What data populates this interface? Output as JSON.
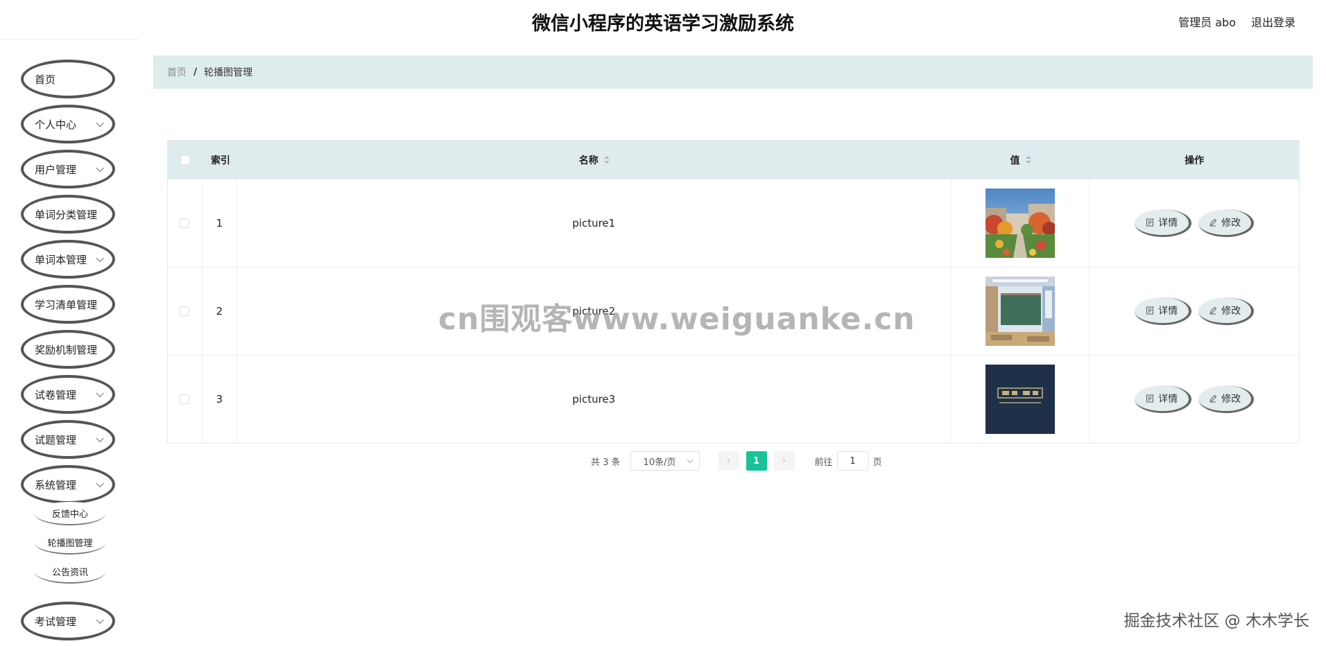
{
  "header": {
    "title": "微信小程序的英语学习激励系统",
    "user": "管理员 abo",
    "logout": "退出登录"
  },
  "sidebar": {
    "items": [
      {
        "label": "首页",
        "has_arrow": false
      },
      {
        "label": "个人中心",
        "has_arrow": true
      },
      {
        "label": "用户管理",
        "has_arrow": true
      },
      {
        "label": "单词分类管理",
        "has_arrow": true
      },
      {
        "label": "单词本管理",
        "has_arrow": true
      },
      {
        "label": "学习清单管理",
        "has_arrow": true
      },
      {
        "label": "奖励机制管理",
        "has_arrow": true
      },
      {
        "label": "试卷管理",
        "has_arrow": true
      },
      {
        "label": "试题管理",
        "has_arrow": true
      },
      {
        "label": "系统管理",
        "has_arrow": true
      },
      {
        "label": "考试管理",
        "has_arrow": true
      }
    ],
    "subitems": [
      "反馈中心",
      "轮播图管理",
      "公告资讯"
    ]
  },
  "breadcrumb": {
    "home": "首页",
    "separator": "/",
    "current": "轮播图管理"
  },
  "table": {
    "headers": {
      "index": "索引",
      "name": "名称",
      "value": "值",
      "actions": "操作"
    },
    "rows": [
      {
        "index": "1",
        "name": "picture1",
        "image": "campus-garden-photo"
      },
      {
        "index": "2",
        "name": "picture2",
        "image": "classroom-blackboard-photo"
      },
      {
        "index": "3",
        "name": "picture3",
        "image": "dark-banner-logo-image"
      }
    ],
    "detail_label": "详情",
    "edit_label": "修改"
  },
  "pagination": {
    "total": "共 3 条",
    "page_size": "10条/页",
    "current_page": "1",
    "goto_prefix": "前往",
    "goto_value": "1",
    "goto_suffix": "页"
  },
  "watermark": {
    "center": "cn围观客www.weiguanke.cn",
    "corner": "掘金技术社区 @ 木木学长"
  },
  "colors": {
    "accent": "#19c39a",
    "header_bg": "#dfecee",
    "button_bg": "#e3edee"
  }
}
